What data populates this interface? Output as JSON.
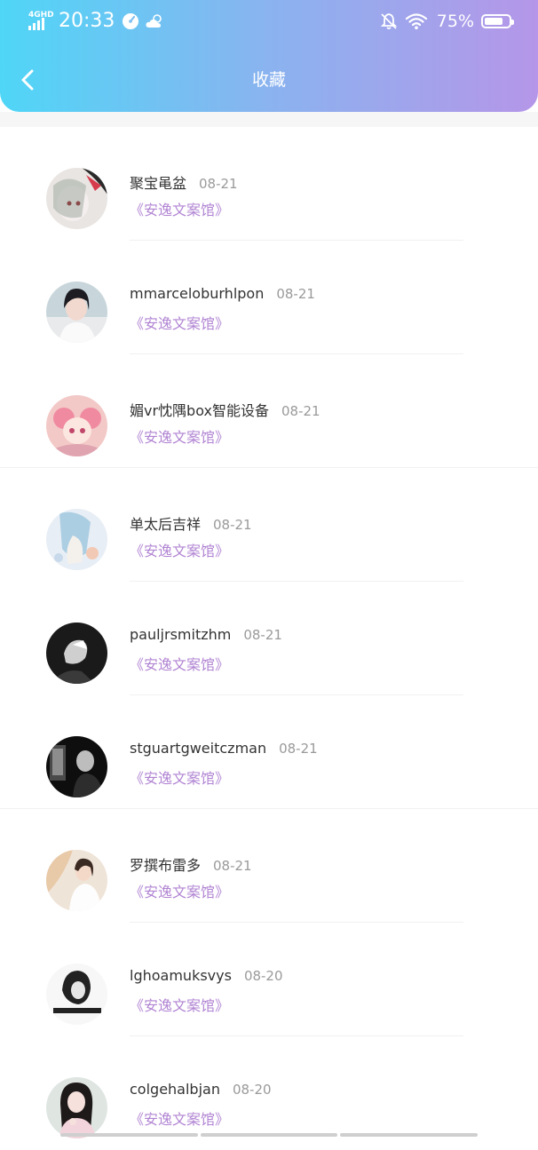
{
  "status_bar": {
    "network": "4GHD",
    "time": "20:33",
    "battery_percent": "75%",
    "battery_level": 0.75,
    "icons": [
      "signal-icon",
      "speedometer-icon",
      "cloud-weather-icon",
      "mute-bell-icon",
      "wifi-icon",
      "battery-icon"
    ]
  },
  "header": {
    "title": "收藏",
    "back_icon": "back-arrow-icon"
  },
  "colors": {
    "gradient_start": "#4fd6f7",
    "gradient_end": "#b596e8",
    "link": "#b184d3",
    "name": "#333333",
    "date": "#9a9a9a"
  },
  "items": [
    {
      "name": "聚宝黾盆",
      "date": "08-21",
      "link": "《安逸文案馆》"
    },
    {
      "name": "mmarceloburhlpon",
      "date": "08-21",
      "link": "《安逸文案馆》"
    },
    {
      "name": "媚vr忱隅box智能设备",
      "date": "08-21",
      "link": "《安逸文案馆》"
    },
    {
      "name": "单太后吉祥",
      "date": "08-21",
      "link": "《安逸文案馆》"
    },
    {
      "name": "pauljrsmitzhm",
      "date": "08-21",
      "link": "《安逸文案馆》"
    },
    {
      "name": "stguartgweitczman",
      "date": "08-21",
      "link": "《安逸文案馆》"
    },
    {
      "name": "罗撰布雷多",
      "date": "08-21",
      "link": "《安逸文案馆》"
    },
    {
      "name": "lghoamuksvys",
      "date": "08-20",
      "link": "《安逸文案馆》"
    },
    {
      "name": "colgehalbjan",
      "date": "08-20",
      "link": "《安逸文案馆》"
    }
  ]
}
